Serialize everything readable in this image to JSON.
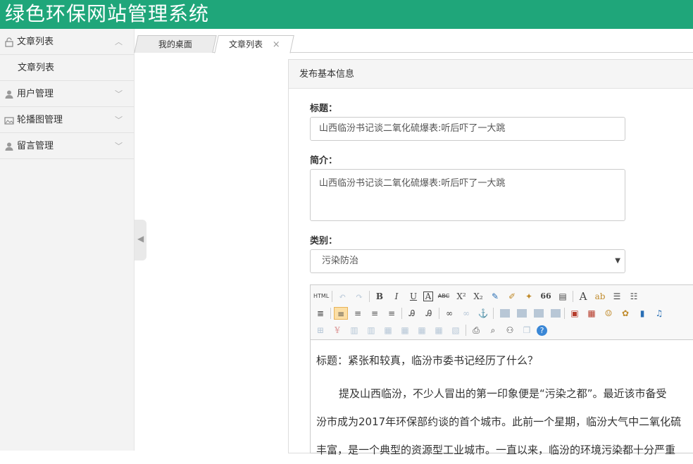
{
  "app": {
    "title": "绿色环保网站管理系统"
  },
  "sidebar": {
    "items": [
      {
        "label": "文章列表",
        "icon": "lock-icon",
        "expanded": true
      },
      {
        "label": "用户管理",
        "icon": "user-icon",
        "expanded": false
      },
      {
        "label": "轮播图管理",
        "icon": "image-icon",
        "expanded": false
      },
      {
        "label": "留言管理",
        "icon": "user-icon",
        "expanded": false
      }
    ],
    "subitems": [
      {
        "label": "文章列表"
      }
    ]
  },
  "tabs": [
    {
      "label": "我的桌面"
    },
    {
      "label": "文章列表",
      "close": "×"
    }
  ],
  "panel": {
    "heading": "发布基本信息"
  },
  "form": {
    "title_label": "标题：",
    "title_value": "山西临汾书记谈二氧化硫爆表:听后吓了一大跳",
    "intro_label": "简介：",
    "intro_value": "山西临汾书记谈二氧化硫爆表:听后吓了一大跳",
    "category_label": "类别：",
    "category_value": "污染防治"
  },
  "editor": {
    "toolbar": {
      "html": "HTML",
      "bold": "B",
      "italic": "I",
      "underline": "U",
      "border": "A",
      "strike": "ABC",
      "sup": "X²",
      "sub": "X₂",
      "quote": "66",
      "fontcolor": "A",
      "help": "?"
    },
    "content_title": "标题：紧张和较真，临汾市委书记经历了什么？",
    "para1": "提及山西临汾，不少人冒出的第一印象便是“污染之都”。最近该市备受",
    "para2": "汾市成为2017年环保部约谈的首个城市。此前一个星期，临汾大气中二氧化硫",
    "para3": "丰富，是一个典型的资源型工业城市。一直以来，临汾的环境污染都十分严重"
  },
  "colors": {
    "header": "#1fa67a",
    "active_align": "#fcdfa5"
  }
}
